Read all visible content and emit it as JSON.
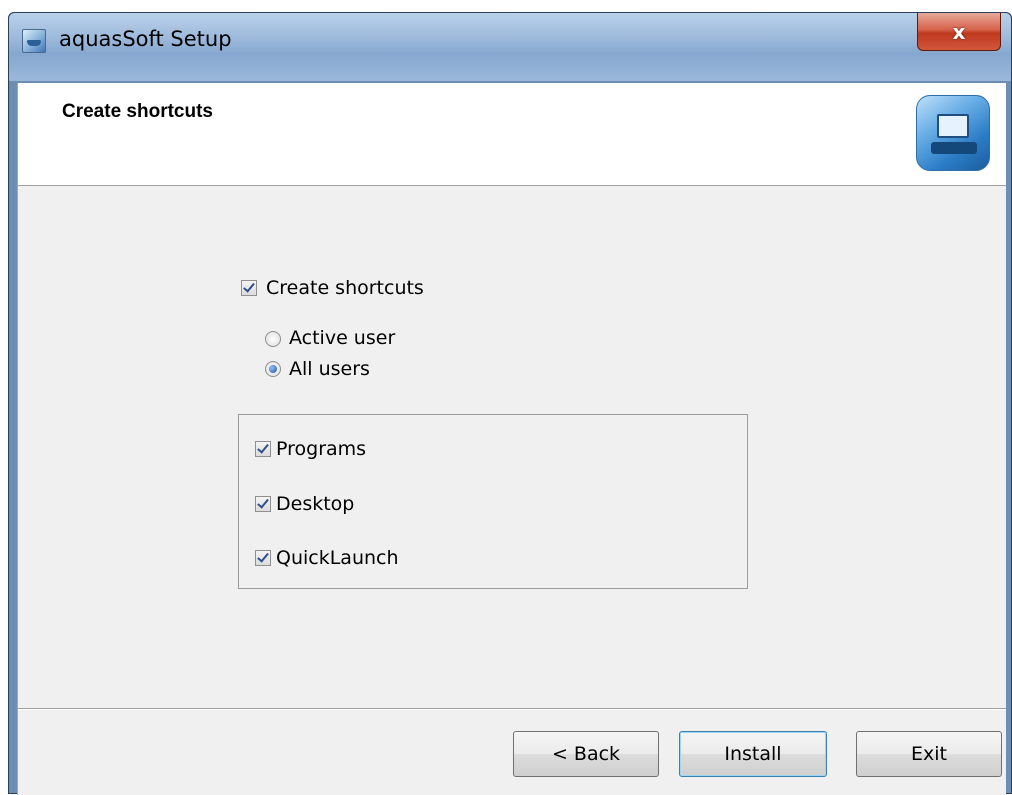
{
  "window": {
    "title": "aquasSoft Setup",
    "close_symbol": "x"
  },
  "header": {
    "title": "Create shortcuts"
  },
  "options": {
    "create_shortcuts": {
      "label": "Create shortcuts",
      "checked": true
    },
    "scope": [
      {
        "label": "Active user",
        "selected": false
      },
      {
        "label": "All users",
        "selected": true
      }
    ],
    "locations": [
      {
        "label": "Programs",
        "checked": true
      },
      {
        "label": "Desktop",
        "checked": true
      },
      {
        "label": "QuickLaunch",
        "checked": true
      }
    ]
  },
  "buttons": {
    "back": "< Back",
    "install": "Install",
    "exit": "Exit"
  }
}
